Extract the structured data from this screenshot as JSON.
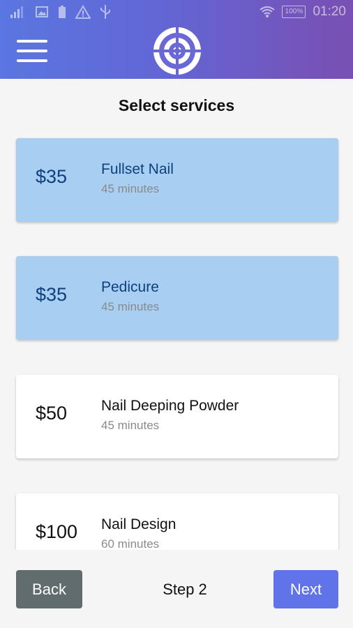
{
  "status_bar": {
    "time": "01:20",
    "battery": "100%",
    "icons": [
      "signal-icon",
      "image-icon",
      "battery-small-icon",
      "warning-icon",
      "usb-icon",
      "wifi-icon",
      "battery-icon"
    ]
  },
  "header": {
    "menu_icon": "hamburger-menu-icon",
    "logo": "target-logo"
  },
  "page": {
    "title": "Select services"
  },
  "services": [
    {
      "price": "$35",
      "name": "Fullset Nail",
      "duration": "45 minutes",
      "selected": true
    },
    {
      "price": "$35",
      "name": "Pedicure",
      "duration": "45 minutes",
      "selected": true
    },
    {
      "price": "$50",
      "name": "Nail Deeping Powder",
      "duration": "45 minutes",
      "selected": false
    },
    {
      "price": "$100",
      "name": "Nail Design",
      "duration": "60 minutes",
      "selected": false
    }
  ],
  "footer": {
    "back_label": "Back",
    "step_label": "Step 2",
    "next_label": "Next"
  },
  "colors": {
    "header_gradient_start": "#5a76e0",
    "header_gradient_end": "#7a4fb2",
    "selected_card": "#a8cef2",
    "back_button": "#616c6e",
    "next_button": "#6073e8"
  }
}
